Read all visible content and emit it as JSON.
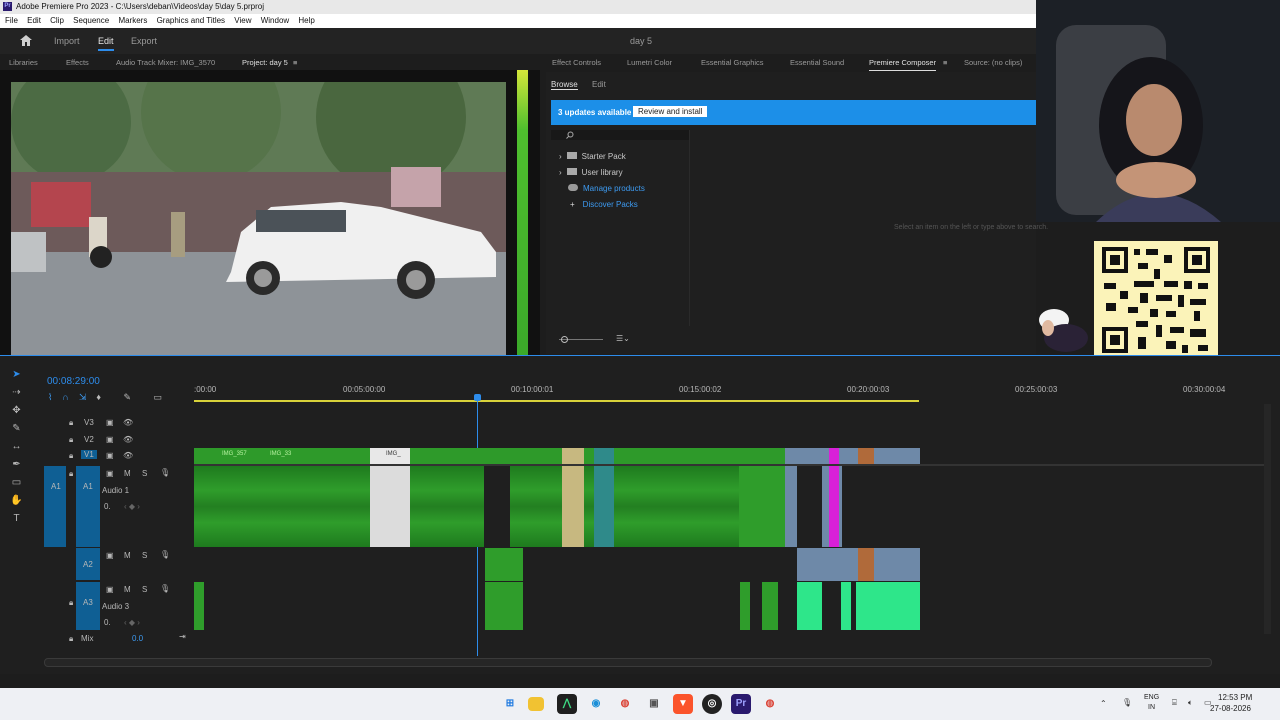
{
  "window": {
    "title": "Adobe Premiere Pro 2023 - C:\\Users\\deban\\Videos\\day 5\\day 5.prproj"
  },
  "menu": [
    "File",
    "Edit",
    "Clip",
    "Sequence",
    "Markers",
    "Graphics and Titles",
    "View",
    "Window",
    "Help"
  ],
  "workspace": {
    "tabs": [
      "Import",
      "Edit",
      "Export"
    ],
    "active": "Edit",
    "project_title": "day 5"
  },
  "left_tabs": [
    "Libraries",
    "Effects",
    "Audio Track Mixer: IMG_3570",
    "Project: day 5"
  ],
  "right_tabs": [
    "Effect Controls",
    "Lumetri Color",
    "Essential Graphics",
    "Essential Sound",
    "Premiere Composer",
    "Source: (no clips)"
  ],
  "composer": {
    "subtabs": [
      "Browse",
      "Edit"
    ],
    "banner_text": "3 updates available",
    "banner_button": "Review and install",
    "search_icon": "search-icon",
    "tree": [
      {
        "label": "Starter Pack",
        "icon": "folder-icon"
      },
      {
        "label": "User library",
        "icon": "folder-icon"
      },
      {
        "label": "Manage products",
        "icon": "cloud-icon"
      },
      {
        "label": "Discover Packs",
        "icon": "plus-icon"
      }
    ],
    "hint": "Select an item on the left or type above to search."
  },
  "timeline": {
    "timecode": "00:08:29:00",
    "ruler": [
      ":00:00",
      "00:05:00:00",
      "00:10:00:01",
      "00:15:00:02",
      "00:20:00:03",
      "00:25:00:03",
      "00:30:00:04"
    ],
    "tracks": [
      {
        "id": "V3",
        "name": ""
      },
      {
        "id": "V2",
        "name": ""
      },
      {
        "id": "V1",
        "name": ""
      },
      {
        "id": "A1",
        "name": "Audio 1"
      },
      {
        "id": "A2",
        "name": ""
      },
      {
        "id": "A3",
        "name": "Audio 3"
      }
    ],
    "mix_label": "Mix",
    "mix_value": "0.0",
    "clip_labels": [
      "IMG_357",
      "IMG_33",
      "IMG_"
    ],
    "volume_value": "0.",
    "track_buttons": [
      "M",
      "S"
    ]
  },
  "taskbar": {
    "lang": "ENG",
    "region": "IN",
    "time": "12:53 PM",
    "date": "27-08-2026"
  },
  "colors": {
    "accent": "#2d8ceb",
    "clip_green": "#2e9a2a",
    "banner": "#1c8fe8",
    "audio_highlight": "#0f5f94"
  }
}
